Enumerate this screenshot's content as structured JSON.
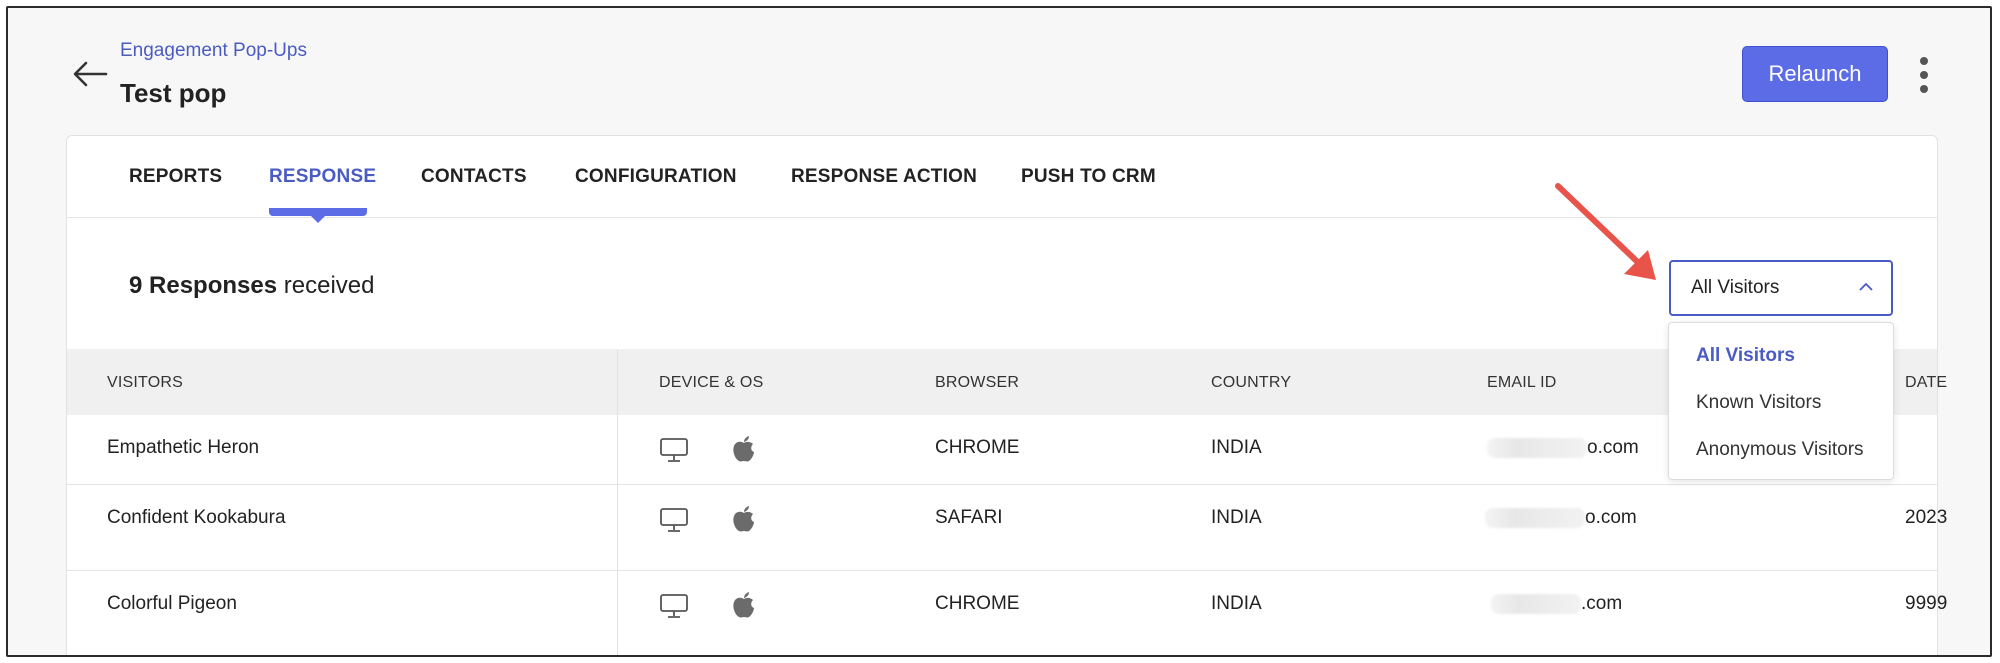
{
  "header": {
    "breadcrumb": "Engagement Pop-Ups",
    "title": "Test pop",
    "relaunch_label": "Relaunch",
    "back_icon": "arrow-left-icon",
    "more_icon": "kebab-icon"
  },
  "tabs": [
    {
      "label": "REPORTS",
      "active": false
    },
    {
      "label": "RESPONSE",
      "active": true
    },
    {
      "label": "CONTACTS",
      "active": false
    },
    {
      "label": "CONFIGURATION",
      "active": false
    },
    {
      "label": "RESPONSE ACTION",
      "active": false
    },
    {
      "label": "PUSH TO CRM",
      "active": false
    }
  ],
  "responses": {
    "count": "9 Responses",
    "suffix": "received"
  },
  "filter": {
    "selected": "All Visitors",
    "open": true,
    "options": [
      "All Visitors",
      "Known Visitors",
      "Anonymous Visitors"
    ]
  },
  "table": {
    "columns": [
      "VISITORS",
      "DEVICE & OS",
      "BROWSER",
      "COUNTRY",
      "EMAIL ID",
      "DATE"
    ],
    "rows": [
      {
        "visitor": "Empathetic Heron",
        "device": "desktop",
        "os": "apple",
        "browser": "CHROME",
        "country": "INDIA",
        "email_suffix": "o.com",
        "date": ""
      },
      {
        "visitor": "Confident Kookabura",
        "device": "desktop",
        "os": "apple",
        "browser": "SAFARI",
        "country": "INDIA",
        "email_suffix": "o.com",
        "date": "2023"
      },
      {
        "visitor": "Colorful Pigeon",
        "device": "desktop",
        "os": "apple",
        "browser": "CHROME",
        "country": "INDIA",
        "email_suffix": ".com",
        "date": "9999"
      }
    ]
  },
  "colors": {
    "accent": "#5b6ce6",
    "link": "#4a5bc4",
    "annotation_arrow": "#e8534a"
  }
}
